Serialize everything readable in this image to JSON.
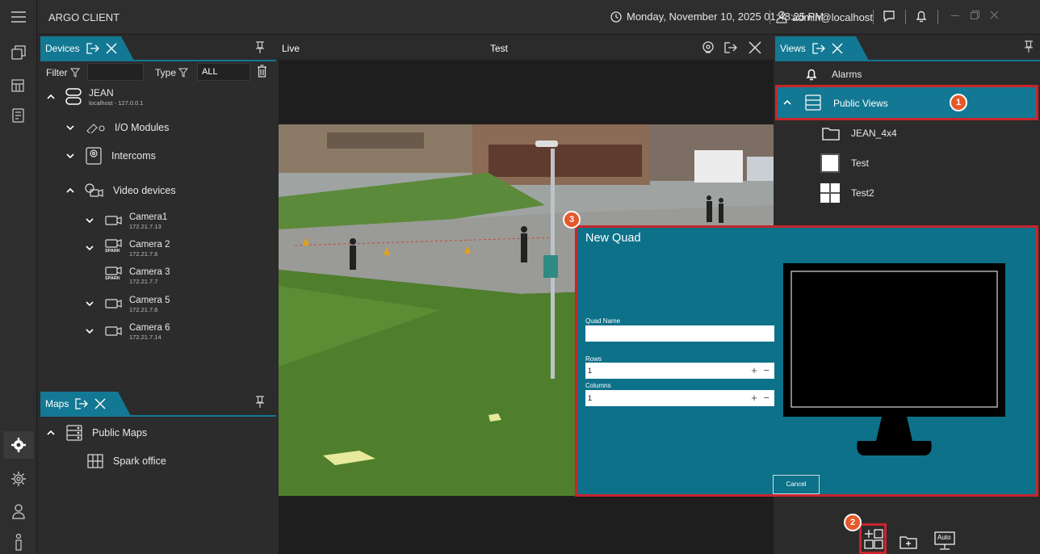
{
  "app": {
    "title": "ARGO CLIENT"
  },
  "topbar": {
    "datetime": "Monday, November 10, 2025 01:48:25 PM",
    "user": "admin@localhost"
  },
  "devices_panel": {
    "tab_label": "Devices",
    "filter_label": "Filter",
    "type_label": "Type",
    "type_value": "ALL",
    "server": {
      "name": "JEAN",
      "address": "localhost - 127.0.0.1"
    },
    "groups": [
      {
        "label": "I/O Modules"
      },
      {
        "label": "Intercoms"
      },
      {
        "label": "Video devices"
      }
    ],
    "cameras": [
      {
        "name": "Camera1",
        "ip": "172.21.7.13",
        "brand": ""
      },
      {
        "name": "Camera 2",
        "ip": "172.21.7.6",
        "brand": "SPARK"
      },
      {
        "name": "Camera 3",
        "ip": "172.21.7.7",
        "brand": "SPARK"
      },
      {
        "name": "Camera 5",
        "ip": "172.21.7.6",
        "brand": ""
      },
      {
        "name": "Camera 6",
        "ip": "172.21.7.14",
        "brand": ""
      }
    ]
  },
  "maps_panel": {
    "tab_label": "Maps",
    "root": "Public Maps",
    "items": [
      {
        "label": "Spark office"
      }
    ]
  },
  "live": {
    "label": "Live",
    "view_name": "Test"
  },
  "views_panel": {
    "tab_label": "Views",
    "alarms": "Alarms",
    "public_views": "Public Views",
    "items": [
      {
        "label": "JEAN_4x4"
      },
      {
        "label": "Test"
      },
      {
        "label": "Test2"
      }
    ],
    "auto_label": "Auto"
  },
  "quad_dialog": {
    "title": "New Quad",
    "name_label": "Quad Name",
    "name_value": "",
    "rows_label": "Rows",
    "rows_value": "1",
    "columns_label": "Columns",
    "columns_value": "1",
    "stepper": "+ −",
    "cancel_label": "Cancel"
  },
  "callouts": [
    "1",
    "2",
    "3"
  ],
  "colors": {
    "accent": "#137893",
    "dialog": "#0d7189",
    "highlight": "#c8252c",
    "badge": "#e5582a"
  }
}
